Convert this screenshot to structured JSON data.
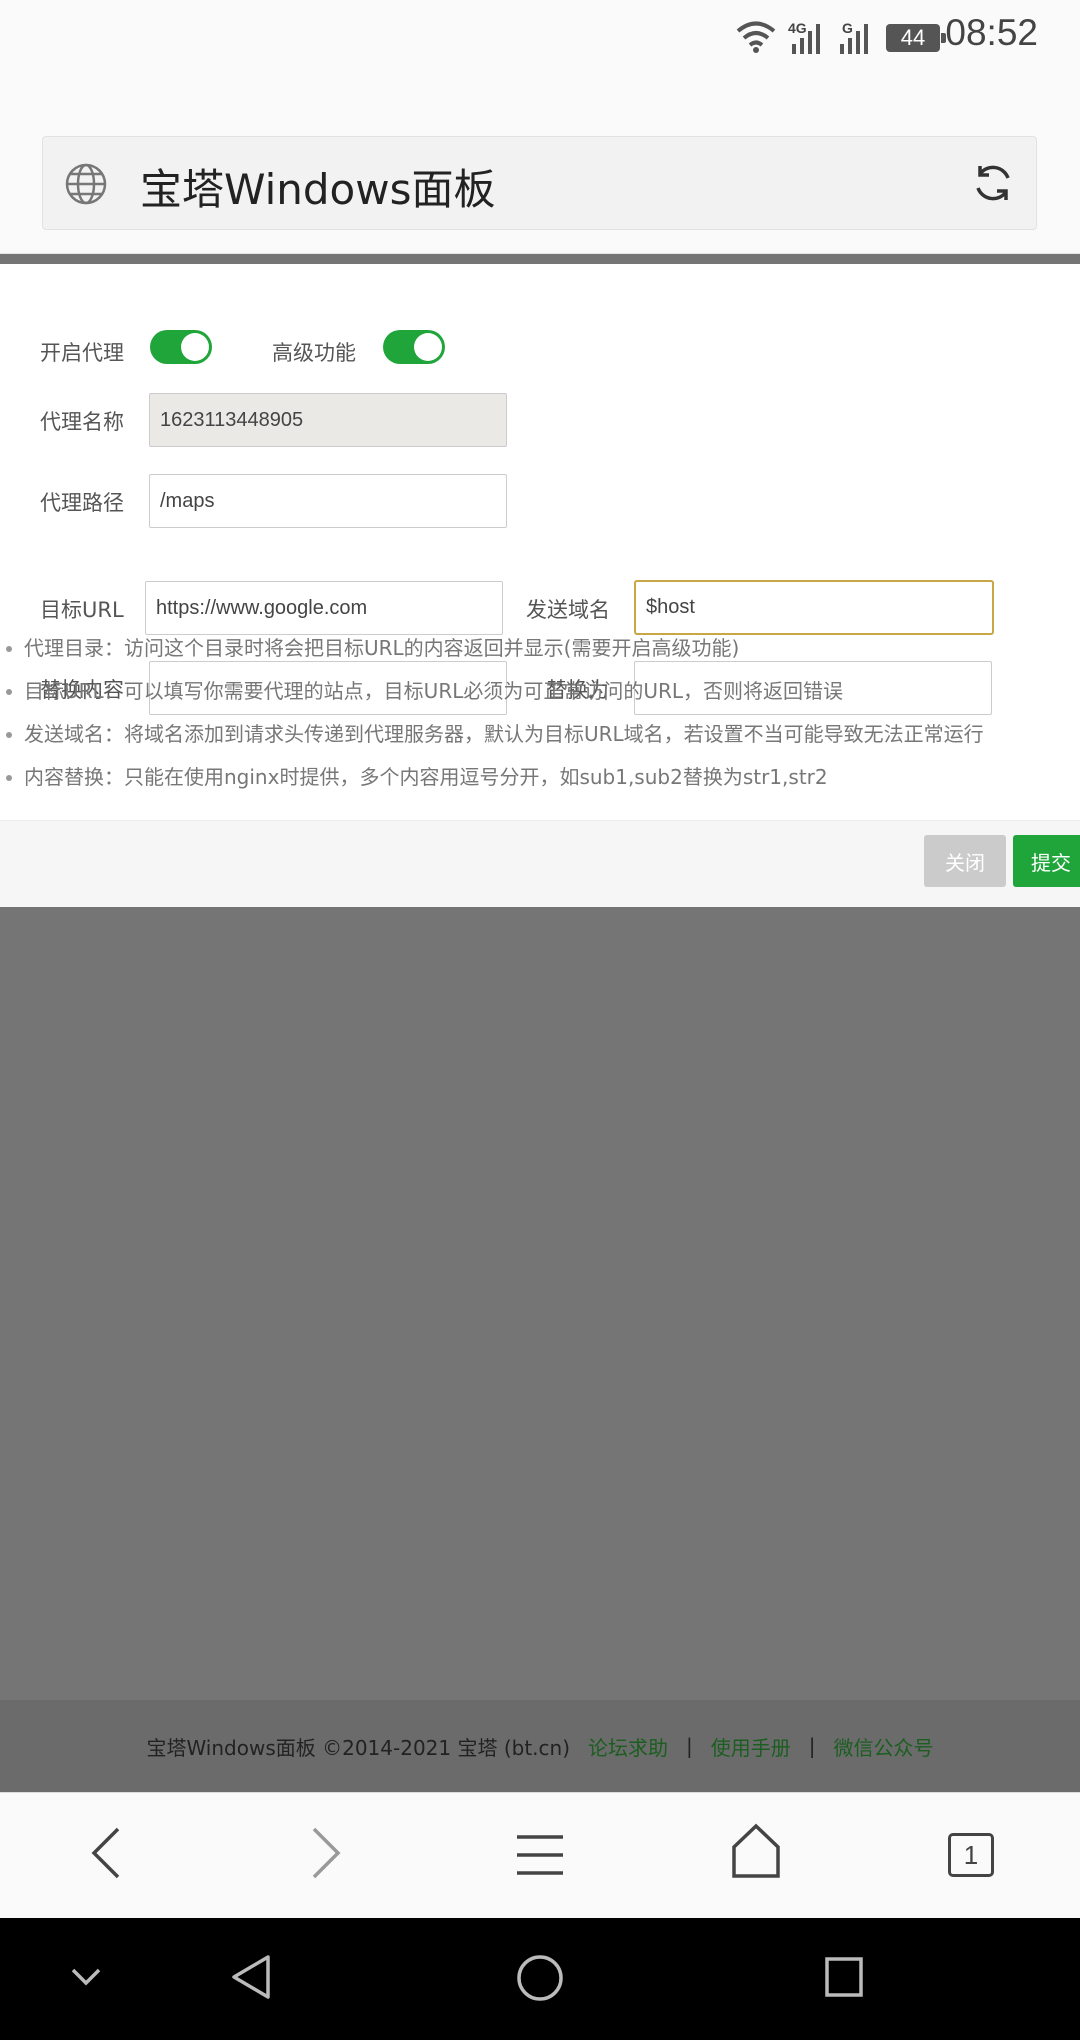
{
  "status_bar": {
    "time": "08:52",
    "battery": "44",
    "network_1": "4G",
    "network_2": "G",
    "icons": [
      "wifi-icon",
      "signal-icon",
      "battery-icon"
    ]
  },
  "browser": {
    "page_title": "宝塔Windows面板",
    "icons": [
      "globe-icon",
      "refresh-icon"
    ]
  },
  "form": {
    "enable_proxy_label": "开启代理",
    "advanced_label": "高级功能",
    "proxy_name_label": "代理名称",
    "proxy_name_value": "1623113448905",
    "proxy_path_label": "代理路径",
    "proxy_path_value": "/maps",
    "target_url_label": "目标URL",
    "target_url_value": "https://www.google.com",
    "send_domain_label": "发送域名",
    "send_domain_value": "$host",
    "replace_content_label": "替换内容",
    "replace_with_label": "替换为",
    "toggle_states": {
      "enable_proxy": true,
      "advanced": true
    }
  },
  "tips": [
    "代理目录：访问这个目录时将会把目标URL的内容返回并显示(需要开启高级功能)",
    "目标URL：可以填写你需要代理的站点，目标URL必须为可正常访问的URL，否则将返回错误",
    "发送域名：将域名添加到请求头传递到代理服务器，默认为目标URL域名，若设置不当可能导致无法正常运行",
    "内容替换：只能在使用nginx时提供，多个内容用逗号分开，如sub1,sub2替换为str1,str2"
  ],
  "dialog_buttons": {
    "close": "关闭",
    "submit": "提交"
  },
  "footer": {
    "copyright": "宝塔Windows面板 ©2014-2021 宝塔 (bt.cn)",
    "links": [
      "论坛求助",
      "使用手册",
      "微信公众号"
    ],
    "separator": "|"
  },
  "browser_bar": {
    "tab_count": "1",
    "icons": [
      "back-icon",
      "forward-icon",
      "menu-icon",
      "home-icon",
      "tabs-icon"
    ]
  },
  "system_nav": {
    "icons": [
      "collapse-icon",
      "system-back-icon",
      "system-home-icon",
      "recents-icon"
    ]
  },
  "colors": {
    "accent_green": "#20a53a",
    "focus_border": "#c9a646",
    "overlay_gray": "#757575"
  }
}
